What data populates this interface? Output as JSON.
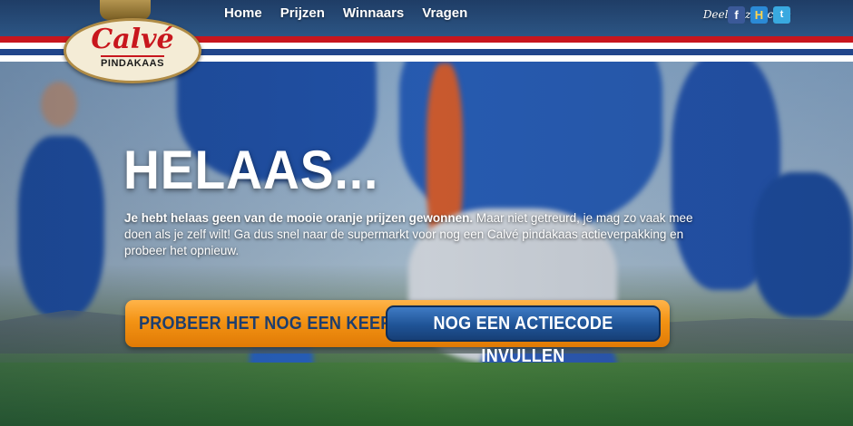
{
  "brand": {
    "name": "Calvé",
    "product": "PINDAKAAS"
  },
  "nav": [
    {
      "label": "Home"
    },
    {
      "label": "Prijzen"
    },
    {
      "label": "Winnaars"
    },
    {
      "label": "Vragen"
    }
  ],
  "share": {
    "label": "Deel deze actie:",
    "icons": [
      "facebook-icon",
      "hyves-icon",
      "twitter-icon"
    ],
    "glyphs": {
      "facebook": "f",
      "hyves": "H",
      "twitter": "t"
    }
  },
  "colors": {
    "flag_red": "#c8161d",
    "flag_white": "#ffffff",
    "flag_blue": "#21468b",
    "cta_orange": "#f39314",
    "cta_blue": "#1f5396"
  },
  "main": {
    "title": "HELAAS...",
    "message_bold": "Je hebt helaas geen van de mooie oranje prijzen gewonnen.",
    "message_rest": " Maar niet getreurd, je mag zo vaak mee doen als je zelf wilt! Ga dus snel naar de supermarkt voor nog een Calvé pindakaas actieverpakking en probeer het opnieuw."
  },
  "cta": {
    "label": "PROBEER HET NOG EEN KEER:",
    "button": "NOG EEN ACTIECODE INVULLEN"
  }
}
